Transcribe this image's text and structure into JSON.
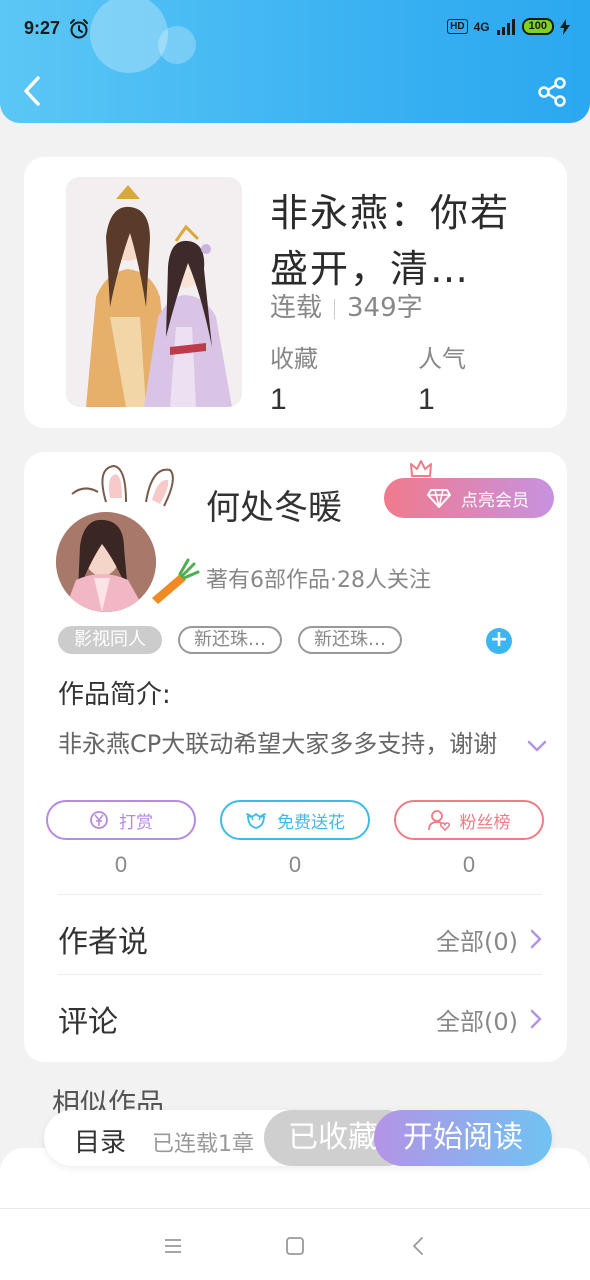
{
  "status_bar": {
    "time": "9:27",
    "hd": "HD",
    "network": "4G",
    "battery": "100"
  },
  "header": {
    "back_icon": "back-chevron-icon",
    "share_icon": "share-icon"
  },
  "book": {
    "title": "非永燕：你若盛开，清…",
    "status": "连载",
    "word_count": "349字",
    "favorites_label": "收藏",
    "favorites_value": "1",
    "popularity_label": "人气",
    "popularity_value": "1"
  },
  "author": {
    "name": "何处冬暖",
    "vip_label": "点亮会员",
    "meta": "著有6部作品·28人关注"
  },
  "tags": [
    "影视同人",
    "新还珠…",
    "新还珠…"
  ],
  "intro": {
    "heading": "作品简介:",
    "text": "非永燕CP大联动希望大家多多支持，谢谢"
  },
  "actions": [
    {
      "label": "打赏",
      "count": "0",
      "color": "#b58ae0"
    },
    {
      "label": "免费送花",
      "count": "0",
      "color": "#3bbce8"
    },
    {
      "label": "粉丝榜",
      "count": "0",
      "color": "#ee7c84"
    }
  ],
  "author_says": {
    "label": "作者说",
    "value": "全部(0)"
  },
  "comments": {
    "label": "评论",
    "value": "全部(0)"
  },
  "similar": {
    "title": "相似作品"
  },
  "bottom_bar": {
    "toc_label": "目录",
    "toc_progress": "已连载1章",
    "collect_label": "已收藏",
    "read_label": "开始阅读"
  },
  "colors": {
    "header": "#3bb2f2",
    "accent_purple": "#b493e6",
    "accent_blue": "#3bb6f2"
  }
}
